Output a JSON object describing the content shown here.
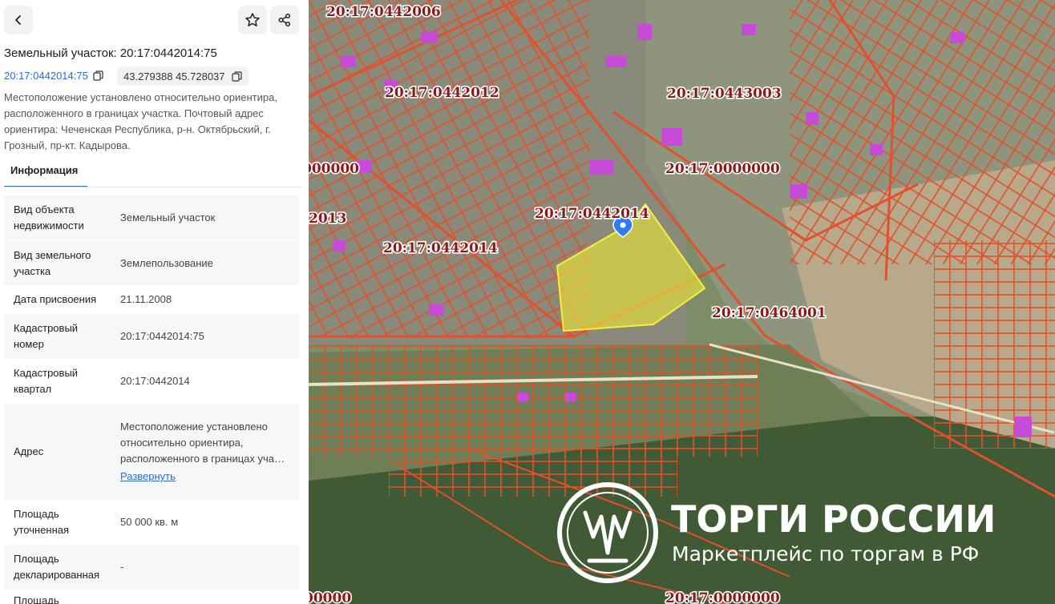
{
  "header": {
    "title": "Земельный участок: 20:17:0442014:75",
    "cad_number_link": "20:17:0442014:75",
    "coordinates": "43.279388 45.728037",
    "description": "Местоположение установлено относительно ориентира, расположенного в границах участка. Почтовый адрес ориентира: Чеченская Республика, р-н. Октябрьский, г. Грозный, пр-кт. Кадырова."
  },
  "tabs": {
    "info": "Информация"
  },
  "info": {
    "rows": [
      {
        "key": "Вид объекта недвижимости",
        "value": "Земельный участок"
      },
      {
        "key": "Вид земельного участка",
        "value": "Землепользование"
      },
      {
        "key": "Дата присвоения",
        "value": "21.11.2008"
      },
      {
        "key": "Кадастровый номер",
        "value": "20:17:0442014:75"
      },
      {
        "key": "Кадастровый квартал",
        "value": "20:17:0442014"
      },
      {
        "key": "Адрес",
        "value": "Местоположение установлено относительно ориентира, расположенного в границах уча…",
        "link": "Развернуть"
      },
      {
        "key": "Площадь уточненная",
        "value": "50 000 кв. м"
      },
      {
        "key": "Площадь декларированная",
        "value": "-"
      },
      {
        "key": "Площадь",
        "value": ""
      }
    ]
  },
  "map": {
    "labels": [
      "20:17:0442006",
      "20:17:0442012",
      "20:17:0443003",
      "20:17:0000000",
      "20:17:0442014",
      "20:17:0442014",
      "20:17:0464001",
      "000000",
      "2013",
      "20:17:0000000",
      "00000"
    ],
    "watermark": {
      "title": "ТОРГИ РОССИИ",
      "subtitle": "Маркетплейс по торгам в РФ"
    }
  },
  "colors": {
    "accent": "#2d6bd6",
    "parcel_lines": "#e2502c",
    "selected_fill": "#e8e23a",
    "building": "#c64bd9",
    "label": "#8a1a1a"
  },
  "icons": {
    "back": "chevron-left-icon",
    "favorite": "star-icon",
    "share": "share-icon",
    "copy": "copy-icon",
    "marker": "map-pin-icon"
  }
}
